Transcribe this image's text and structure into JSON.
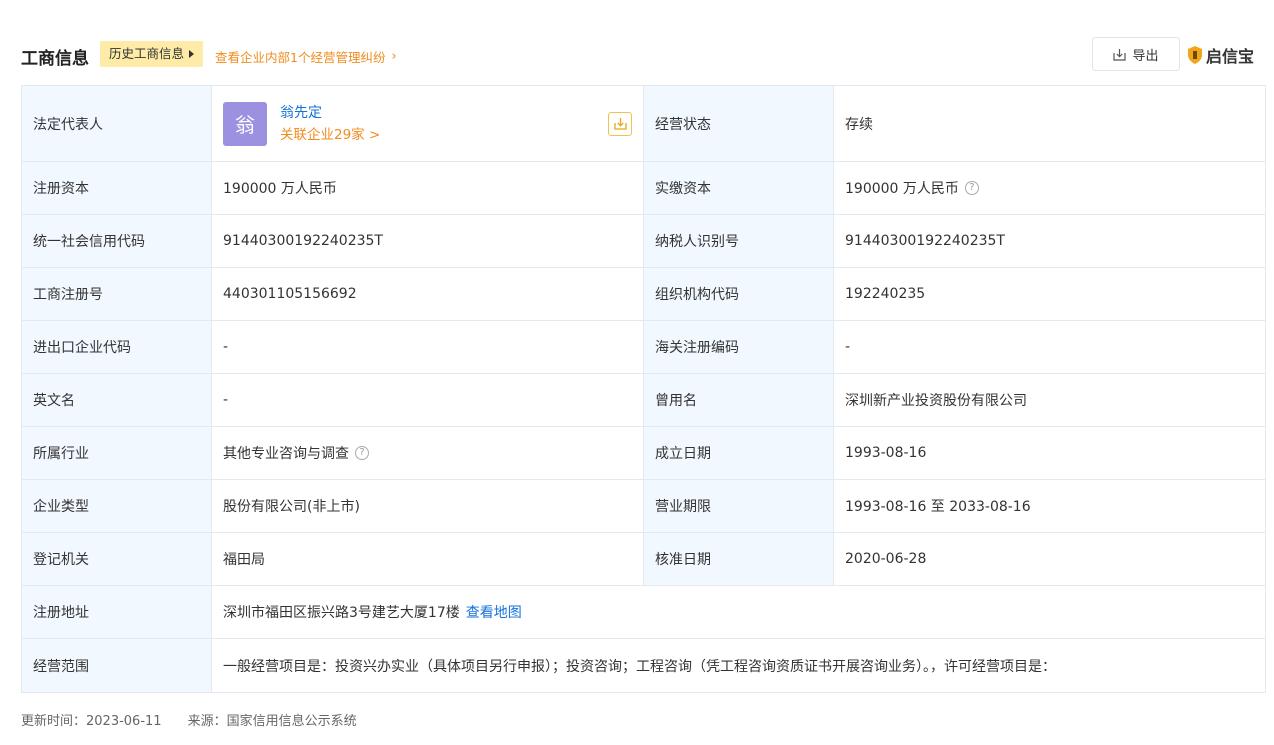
{
  "header": {
    "title": "工商信息",
    "history_label": "历史工商信息",
    "dispute_link": "查看企业内部1个经营管理纠纷",
    "export_label": "导出",
    "brand_label": "启信宝"
  },
  "legal_rep": {
    "label": "法定代表人",
    "avatar_char": "翁",
    "name": "翁先定",
    "related": "关联企业29家 >"
  },
  "business_status": {
    "label": "经营状态",
    "value": "存续"
  },
  "rows": [
    {
      "l1": "注册资本",
      "v1": "190000 万人民币",
      "l2": "实缴资本",
      "v2": "190000 万人民币"
    },
    {
      "l1": "统一社会信用代码",
      "v1": "91440300192240235T",
      "l2": "纳税人识别号",
      "v2": "91440300192240235T"
    },
    {
      "l1": "工商注册号",
      "v1": "440301105156692",
      "l2": "组织机构代码",
      "v2": "192240235"
    },
    {
      "l1": "进出口企业代码",
      "v1": "-",
      "l2": "海关注册编码",
      "v2": "-"
    },
    {
      "l1": "英文名",
      "v1": "-",
      "l2": "曾用名",
      "v2": "深圳新产业投资股份有限公司"
    },
    {
      "l1": "所属行业",
      "v1": "其他专业咨询与调查",
      "l2": "成立日期",
      "v2": "1993-08-16"
    },
    {
      "l1": "企业类型",
      "v1": "股份有限公司(非上市)",
      "l2": "营业期限",
      "v2": "1993-08-16 至 2033-08-16"
    },
    {
      "l1": "登记机关",
      "v1": "福田局",
      "l2": "核准日期",
      "v2": "2020-06-28"
    }
  ],
  "address": {
    "label": "注册地址",
    "value": "深圳市福田区振兴路3号建艺大厦17楼",
    "map_link": "查看地图"
  },
  "scope": {
    "label": "经营范围",
    "value": "一般经营项目是：投资兴办实业（具体项目另行申报）；投资咨询；工程咨询（凭工程咨询资质证书开展咨询业务）。，许可经营项目是："
  },
  "footer": {
    "updated": "更新时间：2023-06-11",
    "source": "来源：国家信用信息公示系统"
  },
  "colors": {
    "accent_orange": "#f08c1e",
    "link_blue": "#1471d8",
    "label_bg": "#f2f8ff",
    "history_bg": "#fdeba7",
    "avatar_bg": "#9c91e0"
  },
  "icons": {
    "help": "question-circle-icon",
    "export": "download-icon",
    "brand": "shield-logo-icon"
  }
}
